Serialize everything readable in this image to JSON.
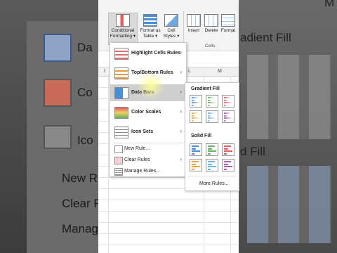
{
  "ribbon": {
    "conditional_formatting": [
      "Conditional",
      "Formatting ▾"
    ],
    "format_as_table": [
      "Format as",
      "Table ▾"
    ],
    "cell_styles": [
      "Cell",
      "Styles ▾"
    ],
    "insert": "Insert",
    "delete": "Delete",
    "format": "Format",
    "cells_group": "Cells"
  },
  "columns": [
    "I",
    "L",
    "M"
  ],
  "menu": {
    "items": [
      {
        "label": "Highlight Cells Rules",
        "icon": "highlight-cells-icon"
      },
      {
        "label": "Top/Bottom Rules",
        "icon": "top-bottom-icon"
      },
      {
        "label": "Data Bars",
        "icon": "data-bars-icon"
      },
      {
        "label": "Color Scales",
        "icon": "color-scales-icon"
      },
      {
        "label": "Icon Sets",
        "icon": "icon-sets-icon"
      }
    ],
    "small_items": [
      "New Rule...",
      "Clear Rules",
      "Manage Rules..."
    ]
  },
  "submenu": {
    "gradient_title": "Gradient Fill",
    "solid_title": "Solid Fill",
    "more_rules": "More Rules...",
    "bar_colors": [
      "#4a8fd6",
      "#63b560",
      "#e0605a",
      "#f0a63c",
      "#6cb6e6",
      "#b05ab0"
    ]
  },
  "background": {
    "left_labels": [
      "Da",
      "Co",
      "Ico",
      "New Ru",
      "Clear R",
      "Manag"
    ],
    "right_labels": [
      "M",
      "adient Fill",
      "d Fill"
    ]
  }
}
